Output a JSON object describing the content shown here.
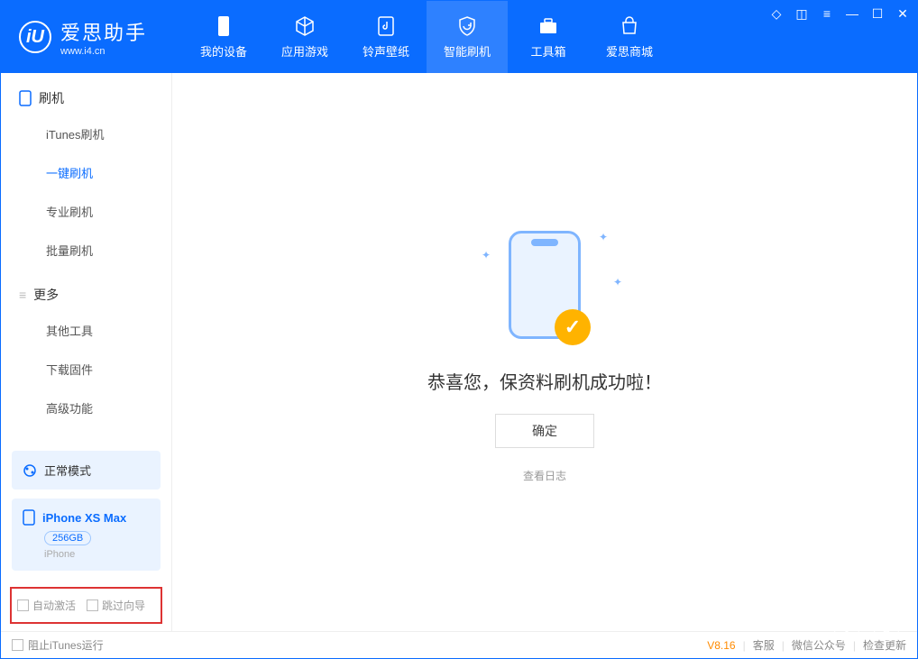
{
  "app": {
    "name": "爱思助手",
    "url": "www.i4.cn"
  },
  "nav": {
    "items": [
      {
        "label": "我的设备"
      },
      {
        "label": "应用游戏"
      },
      {
        "label": "铃声壁纸"
      },
      {
        "label": "智能刷机"
      },
      {
        "label": "工具箱"
      },
      {
        "label": "爱思商城"
      }
    ]
  },
  "sidebar": {
    "group1": {
      "title": "刷机",
      "items": [
        "iTunes刷机",
        "一键刷机",
        "专业刷机",
        "批量刷机"
      ]
    },
    "group2": {
      "title": "更多",
      "items": [
        "其他工具",
        "下载固件",
        "高级功能"
      ]
    },
    "mode": {
      "label": "正常模式"
    },
    "device": {
      "name": "iPhone XS Max",
      "capacity": "256GB",
      "type": "iPhone"
    },
    "checks": {
      "auto_activate": "自动激活",
      "skip_guide": "跳过向导"
    }
  },
  "main": {
    "success": "恭喜您，保资料刷机成功啦！",
    "ok": "确定",
    "view_log": "查看日志"
  },
  "footer": {
    "block_itunes": "阻止iTunes运行",
    "version": "V8.16",
    "links": [
      "客服",
      "微信公众号",
      "检查更新"
    ]
  }
}
